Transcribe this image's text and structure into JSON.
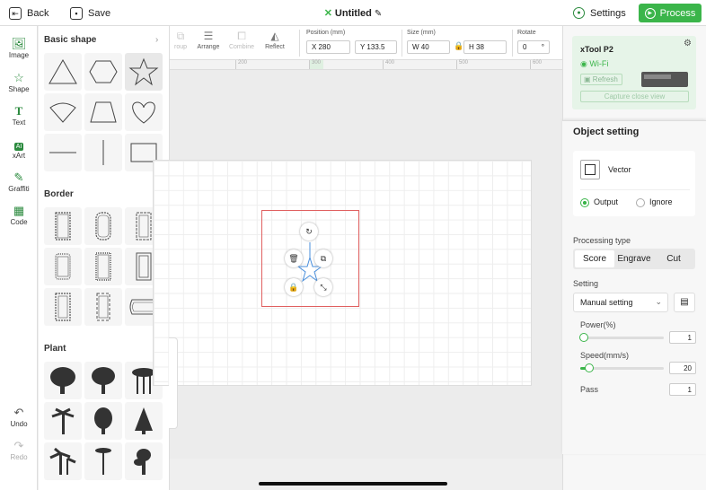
{
  "topbar": {
    "back_label": "Back",
    "save_label": "Save",
    "title": "Untitled",
    "settings_label": "Settings",
    "process_label": "Process"
  },
  "rail": {
    "items": [
      {
        "label": "Image"
      },
      {
        "label": "Shape"
      },
      {
        "label": "Text"
      },
      {
        "label": "xArt",
        "icon_text": "AI"
      },
      {
        "label": "Graffiti"
      },
      {
        "label": "Code"
      }
    ],
    "undo_label": "Undo",
    "redo_label": "Redo"
  },
  "panel": {
    "sections": [
      {
        "title": "Basic shape"
      },
      {
        "title": "Border"
      },
      {
        "title": "Plant"
      }
    ]
  },
  "toolbar": {
    "tools": [
      {
        "label": "roup"
      },
      {
        "label": "Arrange"
      },
      {
        "label": "Combine"
      },
      {
        "label": "Reflect"
      }
    ],
    "position_label": "Position (mm)",
    "x_value": "X 280",
    "y_value": "Y 133.5",
    "size_label": "Size (mm)",
    "w_value": "W 40",
    "h_value": "H 38",
    "rotate_label": "Rotate",
    "rotate_value": "0",
    "rotate_unit": "°"
  },
  "ruler": {
    "ticks": [
      "200",
      "300",
      "400",
      "500",
      "600"
    ]
  },
  "device": {
    "name": "xTool P2",
    "wifi_label": "Wi-Fi",
    "refresh_label": "Refresh",
    "capture_label": "Capture close view"
  },
  "object_setting": {
    "title": "Object setting",
    "type_label": "Vector",
    "output_label": "Output",
    "ignore_label": "Ignore",
    "processing_type_label": "Processing type",
    "processing_types": [
      "Score",
      "Engrave",
      "Cut"
    ],
    "selected_processing_type": "Score",
    "setting_label": "Setting",
    "setting_value": "Manual setting",
    "power_label": "Power(%)",
    "power_value": "1",
    "speed_label": "Speed(mm/s)",
    "speed_value": "20",
    "pass_label": "Pass",
    "pass_value": "1"
  },
  "colors": {
    "accent": "#3bb54a",
    "selection": "#e06060"
  }
}
